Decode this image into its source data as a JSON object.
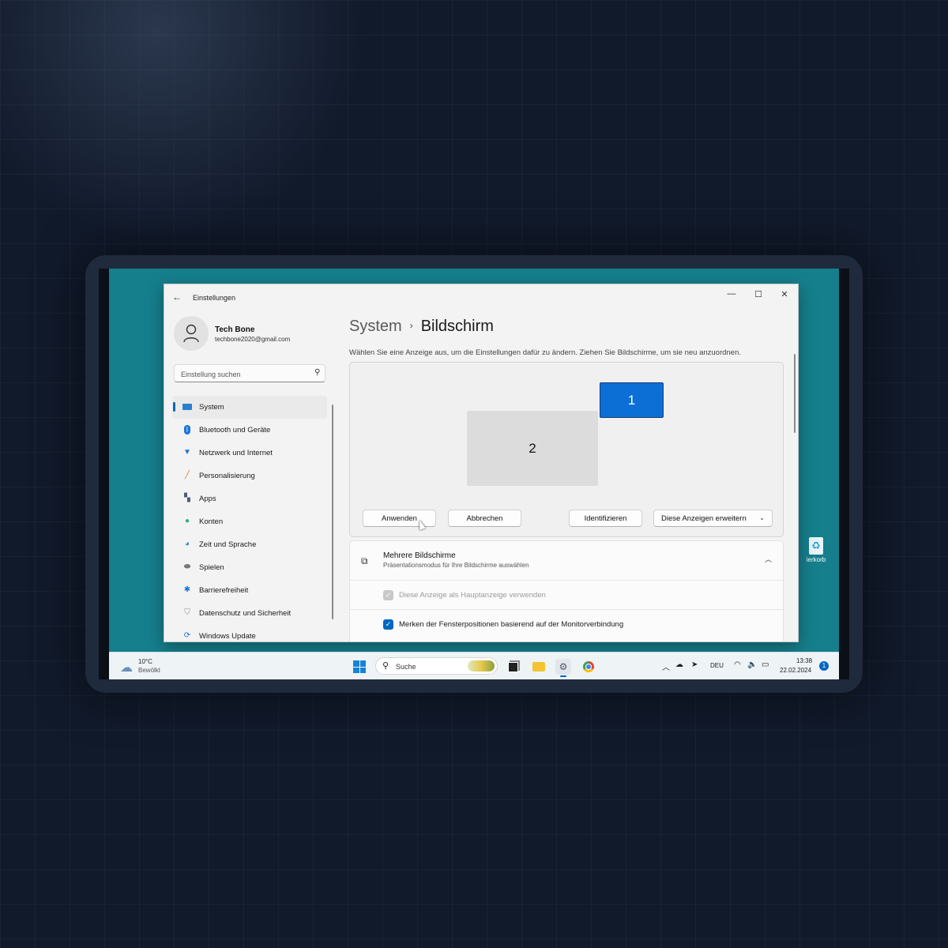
{
  "window": {
    "app_title": "Einstellungen",
    "back_glyph": "←",
    "minimize_glyph": "—",
    "maximize_glyph": "☐",
    "close_glyph": "✕"
  },
  "profile": {
    "name": "Tech Bone",
    "email": "techbone2020@gmail.com"
  },
  "search": {
    "placeholder": "Einstellung suchen"
  },
  "sidebar": {
    "items": [
      {
        "label": "System",
        "icon": "system-icon",
        "active": true
      },
      {
        "label": "Bluetooth und Geräte",
        "icon": "bluetooth-icon"
      },
      {
        "label": "Netzwerk und Internet",
        "icon": "network-icon"
      },
      {
        "label": "Personalisierung",
        "icon": "brush-icon"
      },
      {
        "label": "Apps",
        "icon": "apps-icon"
      },
      {
        "label": "Konten",
        "icon": "account-icon"
      },
      {
        "label": "Zeit und Sprache",
        "icon": "globe-icon"
      },
      {
        "label": "Spielen",
        "icon": "gamepad-icon"
      },
      {
        "label": "Barrierefreiheit",
        "icon": "accessibility-icon"
      },
      {
        "label": "Datenschutz und Sicherheit",
        "icon": "shield-icon"
      },
      {
        "label": "Windows Update",
        "icon": "update-icon"
      }
    ]
  },
  "main": {
    "breadcrumb_parent": "System",
    "breadcrumb_sep": "›",
    "breadcrumb_current": "Bildschirm",
    "intro": "Wählen Sie eine Anzeige aus, um die Einstellungen dafür zu ändern. Ziehen Sie Bildschirme, um sie neu anzuordnen.",
    "monitors": [
      {
        "label": "1",
        "selected": true
      },
      {
        "label": "2",
        "selected": false
      }
    ],
    "buttons": {
      "apply": "Anwenden",
      "cancel": "Abbrechen",
      "identify": "Identifizieren",
      "mode": "Diese Anzeigen erweitern"
    },
    "multi": {
      "title": "Mehrere Bildschirme",
      "subtitle": "Präsentationsmodus für Ihre Bildschirme auswählen",
      "options": [
        {
          "label": "Diese Anzeige als Hauptanzeige verwenden",
          "checked": true,
          "disabled": true
        },
        {
          "label": "Merken der Fensterpositionen basierend auf der Monitorverbindung",
          "checked": true,
          "disabled": false
        }
      ]
    }
  },
  "desktop": {
    "recycle_label": "ierkorb"
  },
  "taskbar": {
    "weather_temp": "10°C",
    "weather_desc": "Bewölkt",
    "search_placeholder": "Suche",
    "language": "DEU",
    "time": "13:38",
    "date": "22.02.2024",
    "notification_count": "1"
  },
  "colors": {
    "accent": "#0067c0",
    "desktop": "#157f8c",
    "monitor_selected": "#0b6fd6"
  }
}
